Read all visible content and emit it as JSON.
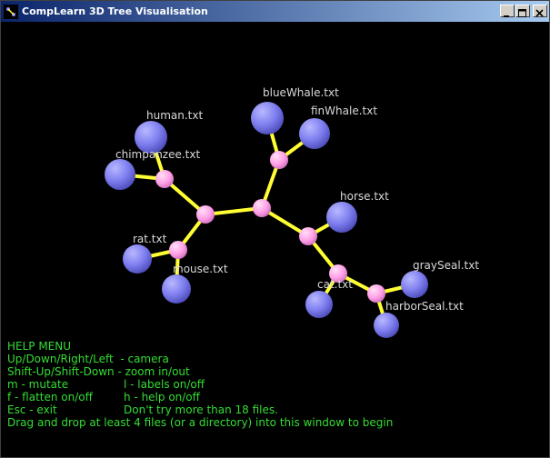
{
  "window": {
    "title": "CompLearn 3D Tree Visualisation",
    "buttons": [
      "minimize-button",
      "maximize-button",
      "close-button"
    ]
  },
  "tree": {
    "leaves": [
      {
        "id": "human",
        "label": "human.txt"
      },
      {
        "id": "chimpanzee",
        "label": "chimpanzee.txt"
      },
      {
        "id": "blueWhale",
        "label": "blueWhale.txt"
      },
      {
        "id": "finWhale",
        "label": "finWhale.txt"
      },
      {
        "id": "horse",
        "label": "horse.txt"
      },
      {
        "id": "rat",
        "label": "rat.txt"
      },
      {
        "id": "mouse",
        "label": "mouse.txt"
      },
      {
        "id": "grayseal",
        "label": "graySeal.txt"
      },
      {
        "id": "cat",
        "label": "cat.txt"
      },
      {
        "id": "harborSeal",
        "label": "harborSeal.txt"
      }
    ],
    "colors": {
      "leaf": "#8888ff",
      "internal": "#ffaaee",
      "edge": "#ffff33",
      "label": "#d8d8d8"
    }
  },
  "help": {
    "title": "HELP MENU",
    "rows": [
      {
        "left": "Up/Down/Right/Left  - camera",
        "right": ""
      },
      {
        "left": "Shift-Up/Shift-Down - zoom in/out",
        "right": ""
      },
      {
        "left": "m - mutate",
        "right": "l - labels on/off"
      },
      {
        "left": "f - flatten on/off",
        "right": "h - help on/off"
      },
      {
        "left": "Esc - exit",
        "right": "Don't try more than 18 files."
      },
      {
        "left": "Drag and drop at least 4 files (or a directory) into this window to begin",
        "right": ""
      }
    ],
    "color": "#33dd33"
  }
}
